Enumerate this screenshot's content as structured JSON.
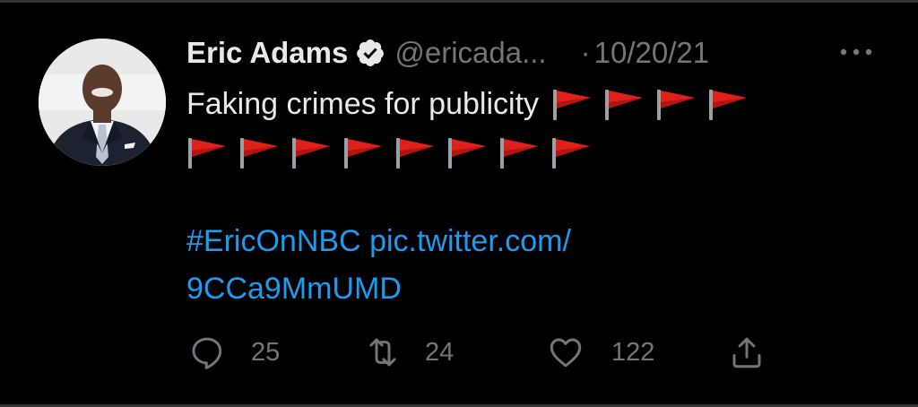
{
  "tweet": {
    "display_name": "Eric Adams",
    "handle": "@ericada...",
    "dot": "·",
    "date": "10/20/21",
    "text_line1": "Faking crimes for publicity",
    "flags_line1": 4,
    "flags_line2": 8,
    "hashtag": "#EricOnNBC",
    "link_part1": "pic.twitter.com/",
    "link_part2": "9CCa9MmUMD"
  },
  "icons": {
    "verified": "verified-badge-icon",
    "more": "more-options-icon",
    "flag": "red-triangular-flag-emoji",
    "reply": "reply-icon",
    "retweet": "retweet-icon",
    "like": "like-icon",
    "share": "share-icon"
  },
  "actions": {
    "reply_count": "25",
    "retweet_count": "24",
    "like_count": "122"
  },
  "colors": {
    "background": "#000000",
    "text": "#e7e9ea",
    "secondary": "#71767b",
    "link": "#1d9bf0",
    "flag": "#e0201b"
  }
}
